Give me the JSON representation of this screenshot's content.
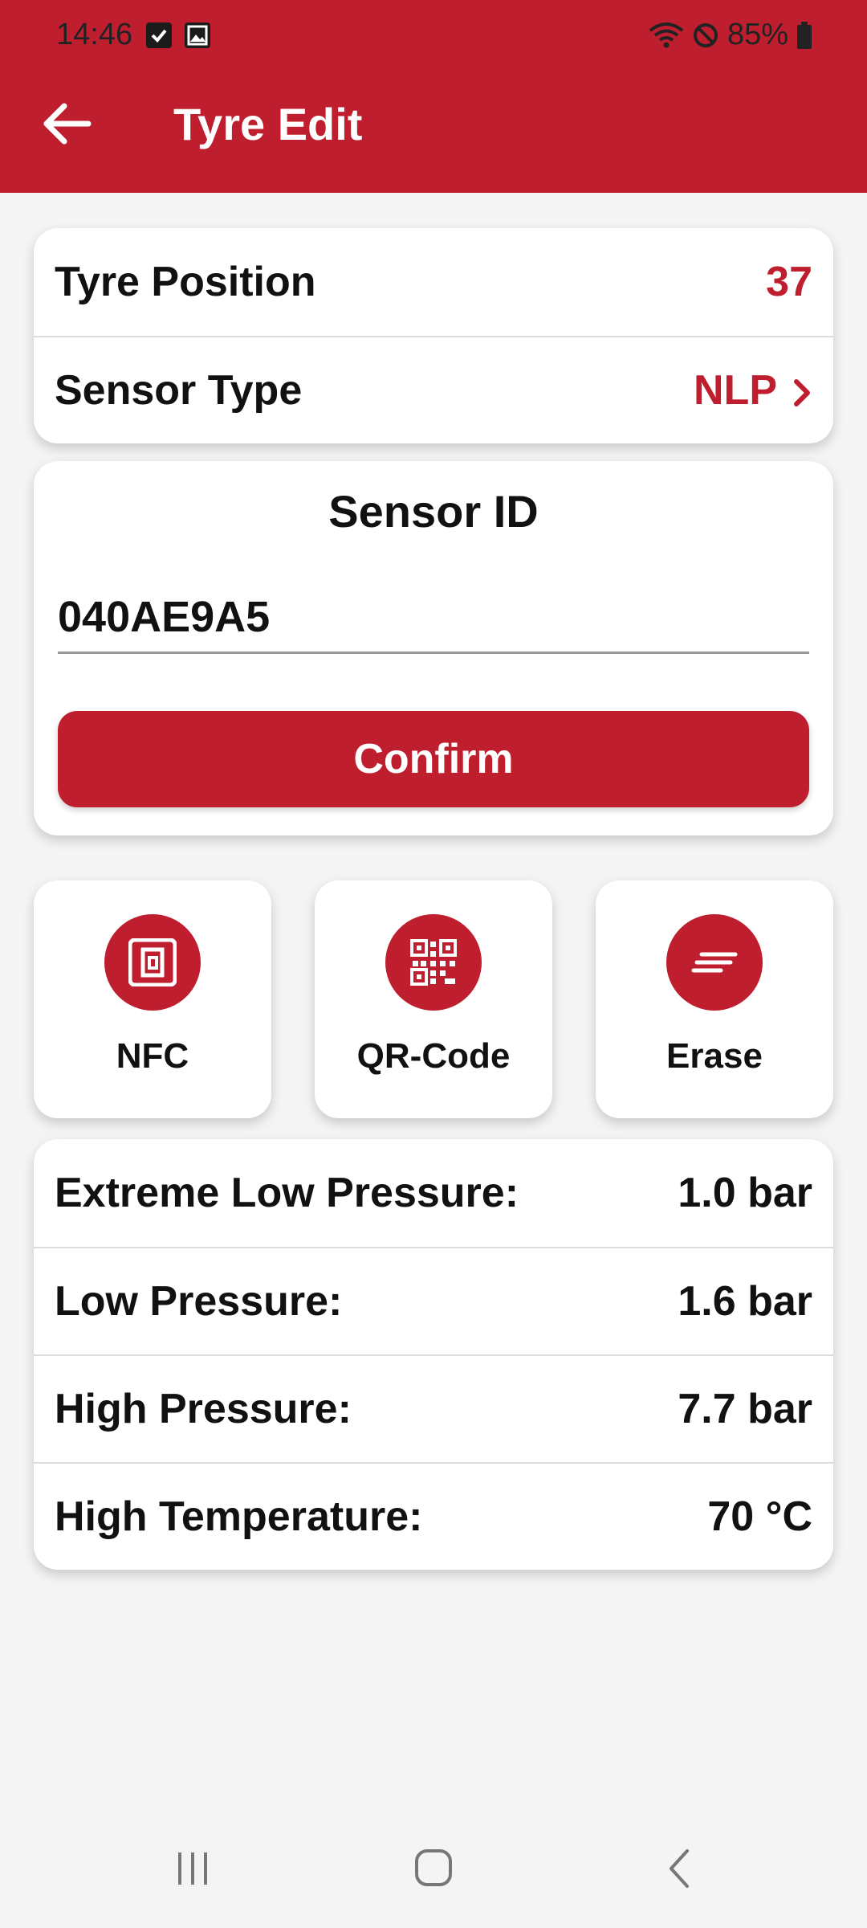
{
  "status": {
    "time": "14:46",
    "battery": "85%"
  },
  "appbar": {
    "title": "Tyre Edit"
  },
  "info": {
    "position_label": "Tyre Position",
    "position_value": "37",
    "sensor_type_label": "Sensor Type",
    "sensor_type_value": "NLP"
  },
  "sensor": {
    "title": "Sensor ID",
    "id_value": "040AE9A5",
    "confirm_label": "Confirm"
  },
  "actions": [
    {
      "label": "NFC",
      "icon": "nfc-icon"
    },
    {
      "label": "QR-Code",
      "icon": "qr-code-icon"
    },
    {
      "label": "Erase",
      "icon": "erase-icon"
    }
  ],
  "thresholds": [
    {
      "label": "Extreme Low Pressure:",
      "value": "1.0 bar"
    },
    {
      "label": "Low Pressure:",
      "value": "1.6 bar"
    },
    {
      "label": "High Pressure:",
      "value": "7.7 bar"
    },
    {
      "label": "High Temperature:",
      "value": "70 °C"
    }
  ],
  "colors": {
    "brand": "#bf1e2e",
    "background": "#f4f4f4"
  }
}
